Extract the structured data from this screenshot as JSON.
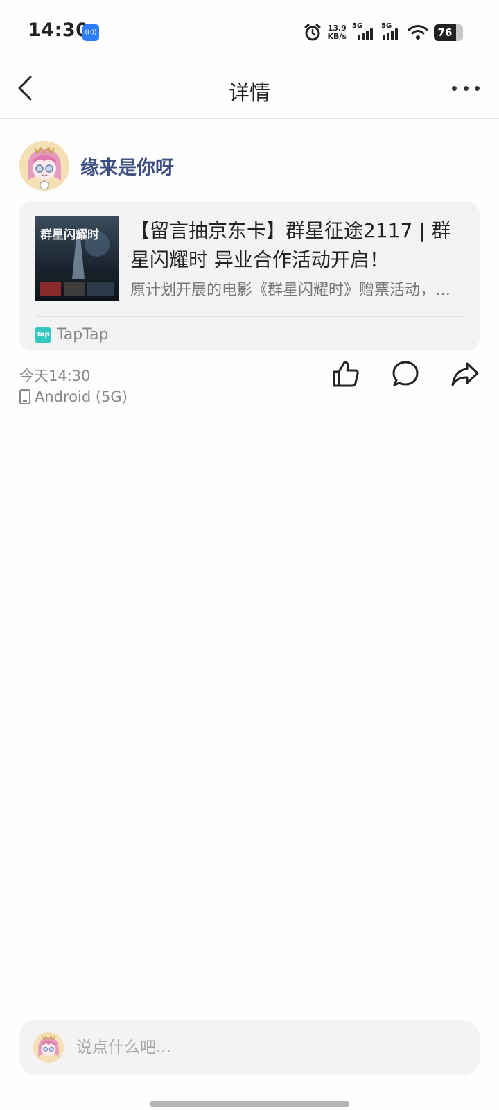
{
  "status_bar": {
    "time": "14:30",
    "hotspot_icon": "hotspot-icon",
    "net_speed_value": "13.9",
    "net_speed_unit": "KB/s",
    "sim1_label": "5G",
    "sim2_label": "5G",
    "battery_level": "76"
  },
  "nav": {
    "title": "详情",
    "back_icon": "chevron-left-icon",
    "more_icon": "more-horizontal-icon"
  },
  "post": {
    "username": "缘来是你呀",
    "time": "今天14:30",
    "device": "Android (5G)",
    "actions": [
      "thumbs-up-icon",
      "comment-icon",
      "share-icon"
    ]
  },
  "share_card": {
    "title": "【留言抽京东卡】群星征途2117 | 群星闪耀时 异业合作活动开启！",
    "description": "原计划开展的电影《群星闪耀时》赠票活动，因故调整为留言抽京东卡",
    "thumb_text": "群星闪耀时",
    "source_icon_text": "Tap",
    "source_name": "TapTap"
  },
  "comment_bar": {
    "placeholder": "说点什么吧..."
  },
  "colors": {
    "username": "#3e4f83",
    "card_bg": "#f3f3f3",
    "taptap": "#35c8c3",
    "meta_text": "#888888"
  }
}
